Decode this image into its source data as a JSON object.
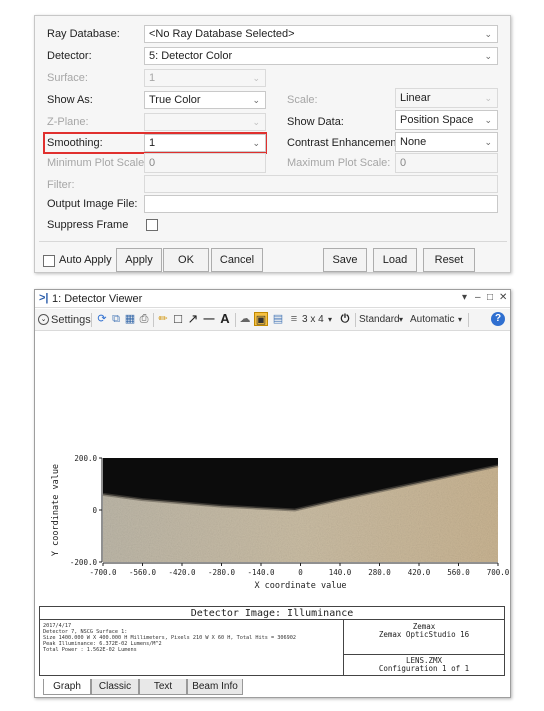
{
  "dialog": {
    "ray_database": {
      "label": "Ray Database:",
      "value": "<No Ray Database Selected>"
    },
    "detector": {
      "label": "Detector:",
      "value": "5: Detector Color"
    },
    "surface": {
      "label": "Surface:",
      "value": "1"
    },
    "show_as": {
      "label": "Show As:",
      "value": "True Color"
    },
    "scale": {
      "label": "Scale:",
      "value": "Linear"
    },
    "z_plane": {
      "label": "Z-Plane:",
      "value": ""
    },
    "show_data": {
      "label": "Show Data:",
      "value": "Position Space"
    },
    "smoothing": {
      "label": "Smoothing:",
      "value": "1"
    },
    "contrast": {
      "label": "Contrast Enhancement:",
      "value": "None"
    },
    "min_plot_scale": {
      "label": "Minimum Plot Scale:",
      "value": "0"
    },
    "max_plot_scale": {
      "label": "Maximum Plot Scale:",
      "value": "0"
    },
    "filter": {
      "label": "Filter:",
      "value": ""
    },
    "output_image_file": {
      "label": "Output Image File:",
      "value": ""
    },
    "suppress_frame": {
      "label": "Suppress Frame",
      "checked": false
    },
    "buttons": {
      "auto_apply": "Auto Apply",
      "apply": "Apply",
      "ok": "OK",
      "cancel": "Cancel",
      "save": "Save",
      "load": "Load",
      "reset": "Reset"
    }
  },
  "viewer": {
    "title": "1: Detector Viewer",
    "toolbar": {
      "settings": "Settings",
      "grid_label": "3 x 4",
      "standard": "Standard",
      "automatic": "Automatic"
    },
    "plot": {
      "ylabel": "Y coordinate value",
      "xlabel": "X coordinate value",
      "x_ticks": [
        "-700.0",
        "-560.0",
        "-420.0",
        "-280.0",
        "-140.0",
        "0",
        "140.0",
        "280.0",
        "420.0",
        "560.0",
        "700.0"
      ],
      "y_ticks": [
        "200.0",
        "0",
        "-200.0"
      ]
    },
    "info": {
      "title": "Detector Image: Illuminance",
      "lines": [
        "2017/4/17",
        "Detector 7, NSCG Surface 1:",
        "Size 1400.000 W X 400.000 H Millimeters, Pixels 210 W X 60 H, Total Hits = 306902",
        "Peak Illuminance: 6.372E-02 Lumens/M^2",
        "Total Power    : 1.562E-02 Lumens"
      ],
      "company": "Zemax",
      "product": "Zemax OpticStudio 16",
      "file": "LENS.ZMX",
      "config": "Configuration 1 of 1"
    },
    "tabs": [
      "Graph",
      "Classic",
      "Text",
      "Beam Info"
    ]
  },
  "chart_data": {
    "type": "heatmap",
    "xlabel": "X coordinate value",
    "ylabel": "Y coordinate value",
    "xlim": [
      -700,
      700
    ],
    "ylim": [
      -200,
      200
    ],
    "x_ticks": [
      -700,
      -560,
      -420,
      -280,
      -140,
      0,
      140,
      280,
      420,
      560,
      700
    ],
    "y_ticks": [
      200,
      0,
      -200
    ],
    "cutoff_profile": [
      {
        "x": -700,
        "y": 60
      },
      {
        "x": -560,
        "y": 40
      },
      {
        "x": -280,
        "y": 15
      },
      {
        "x": -20,
        "y": 0
      },
      {
        "x": 140,
        "y": 40
      },
      {
        "x": 420,
        "y": 105
      },
      {
        "x": 700,
        "y": 170
      }
    ],
    "colors": {
      "dark": "#0c0c0c",
      "light": "#c8b79c"
    }
  }
}
